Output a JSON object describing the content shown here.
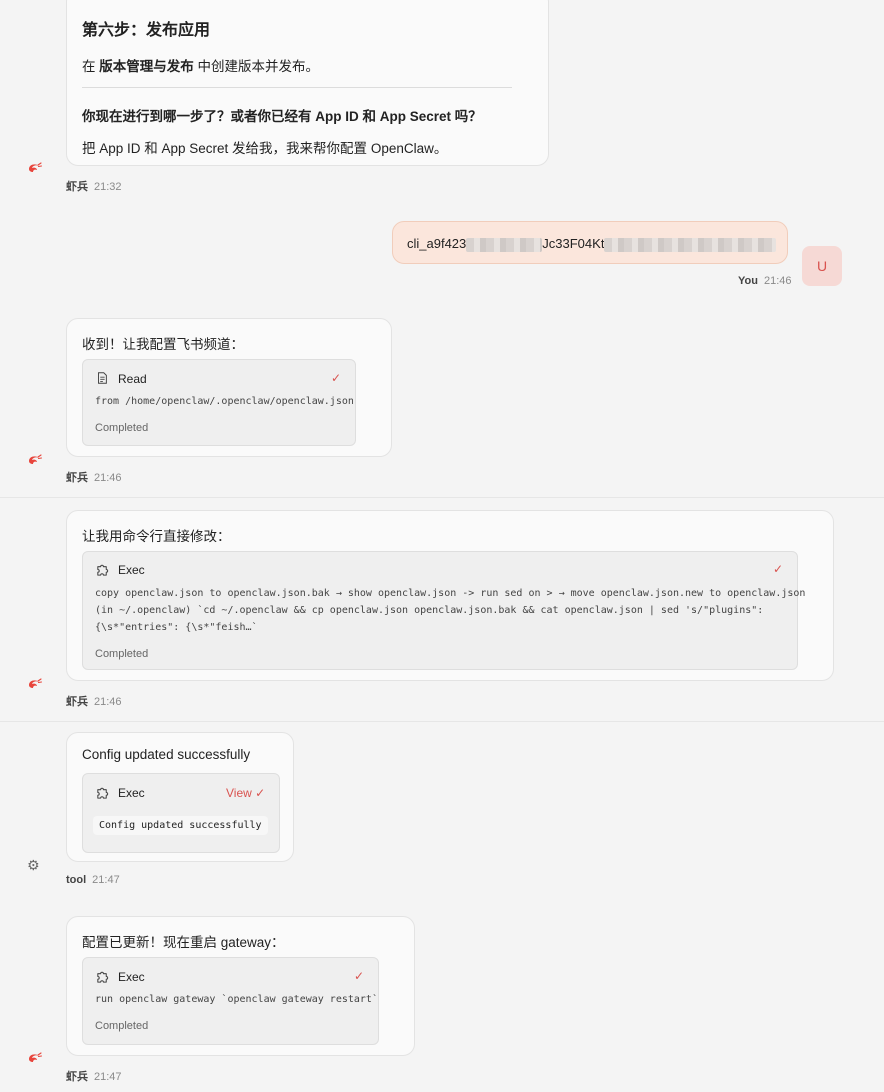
{
  "messages": {
    "m1": {
      "heading": "第六步：发布应用",
      "line1_prefix": "在 ",
      "line1_bold": "版本管理与发布",
      "line1_suffix": " 中创建版本并发布。",
      "question": "你现在进行到哪一步了？或者你已经有 App ID 和 App Secret 吗？",
      "line3": "把 App ID 和 App Secret 发给我，我来帮你配置 OpenClaw。",
      "sender": "虾兵",
      "time": "21:32"
    },
    "m2": {
      "text_part1": "cli_a9f423",
      "text_part2": "Jc33F04Kt",
      "sender": "You",
      "time": "21:46",
      "avatar_letter": "U"
    },
    "m3": {
      "text": "收到！让我配置飞书频道：",
      "tool_name": "Read",
      "tool_detail": "from /home/openclaw/.openclaw/openclaw.json",
      "status": "Completed",
      "sender": "虾兵",
      "time": "21:46"
    },
    "m4": {
      "text": "让我用命令行直接修改：",
      "tool_name": "Exec",
      "detail_line1": "copy openclaw.json to openclaw.json.bak → show openclaw.json -> run sed on > → move openclaw.json.new to openclaw.json",
      "detail_line2": "(in ~/.openclaw) `cd ~/.openclaw && cp openclaw.json openclaw.json.bak && cat openclaw.json | sed 's/\"plugins\":",
      "detail_line3": "{\\s*\"entries\": {\\s*\"feish…`",
      "status": "Completed",
      "sender": "虾兵",
      "time": "21:46"
    },
    "m5": {
      "text": "Config updated successfully",
      "tool_name": "Exec",
      "view_label": "View",
      "output": "Config updated successfully",
      "sender": "tool",
      "time": "21:47"
    },
    "m6": {
      "text": "配置已更新！现在重启 gateway：",
      "tool_name": "Exec",
      "detail": "run openclaw gateway `openclaw gateway restart`",
      "status": "Completed",
      "sender": "虾兵",
      "time": "21:47"
    }
  },
  "icons": {
    "check": "✓",
    "agent_avatar": "shrimp-icon",
    "tool_avatar": "gear-icon",
    "read_tool": "document-icon",
    "exec_tool": "puzzle-icon"
  },
  "colors": {
    "accent_red": "#d9534f",
    "user_bubble_bg": "#fbe6dc",
    "user_avatar_bg": "#f6d9d5"
  }
}
